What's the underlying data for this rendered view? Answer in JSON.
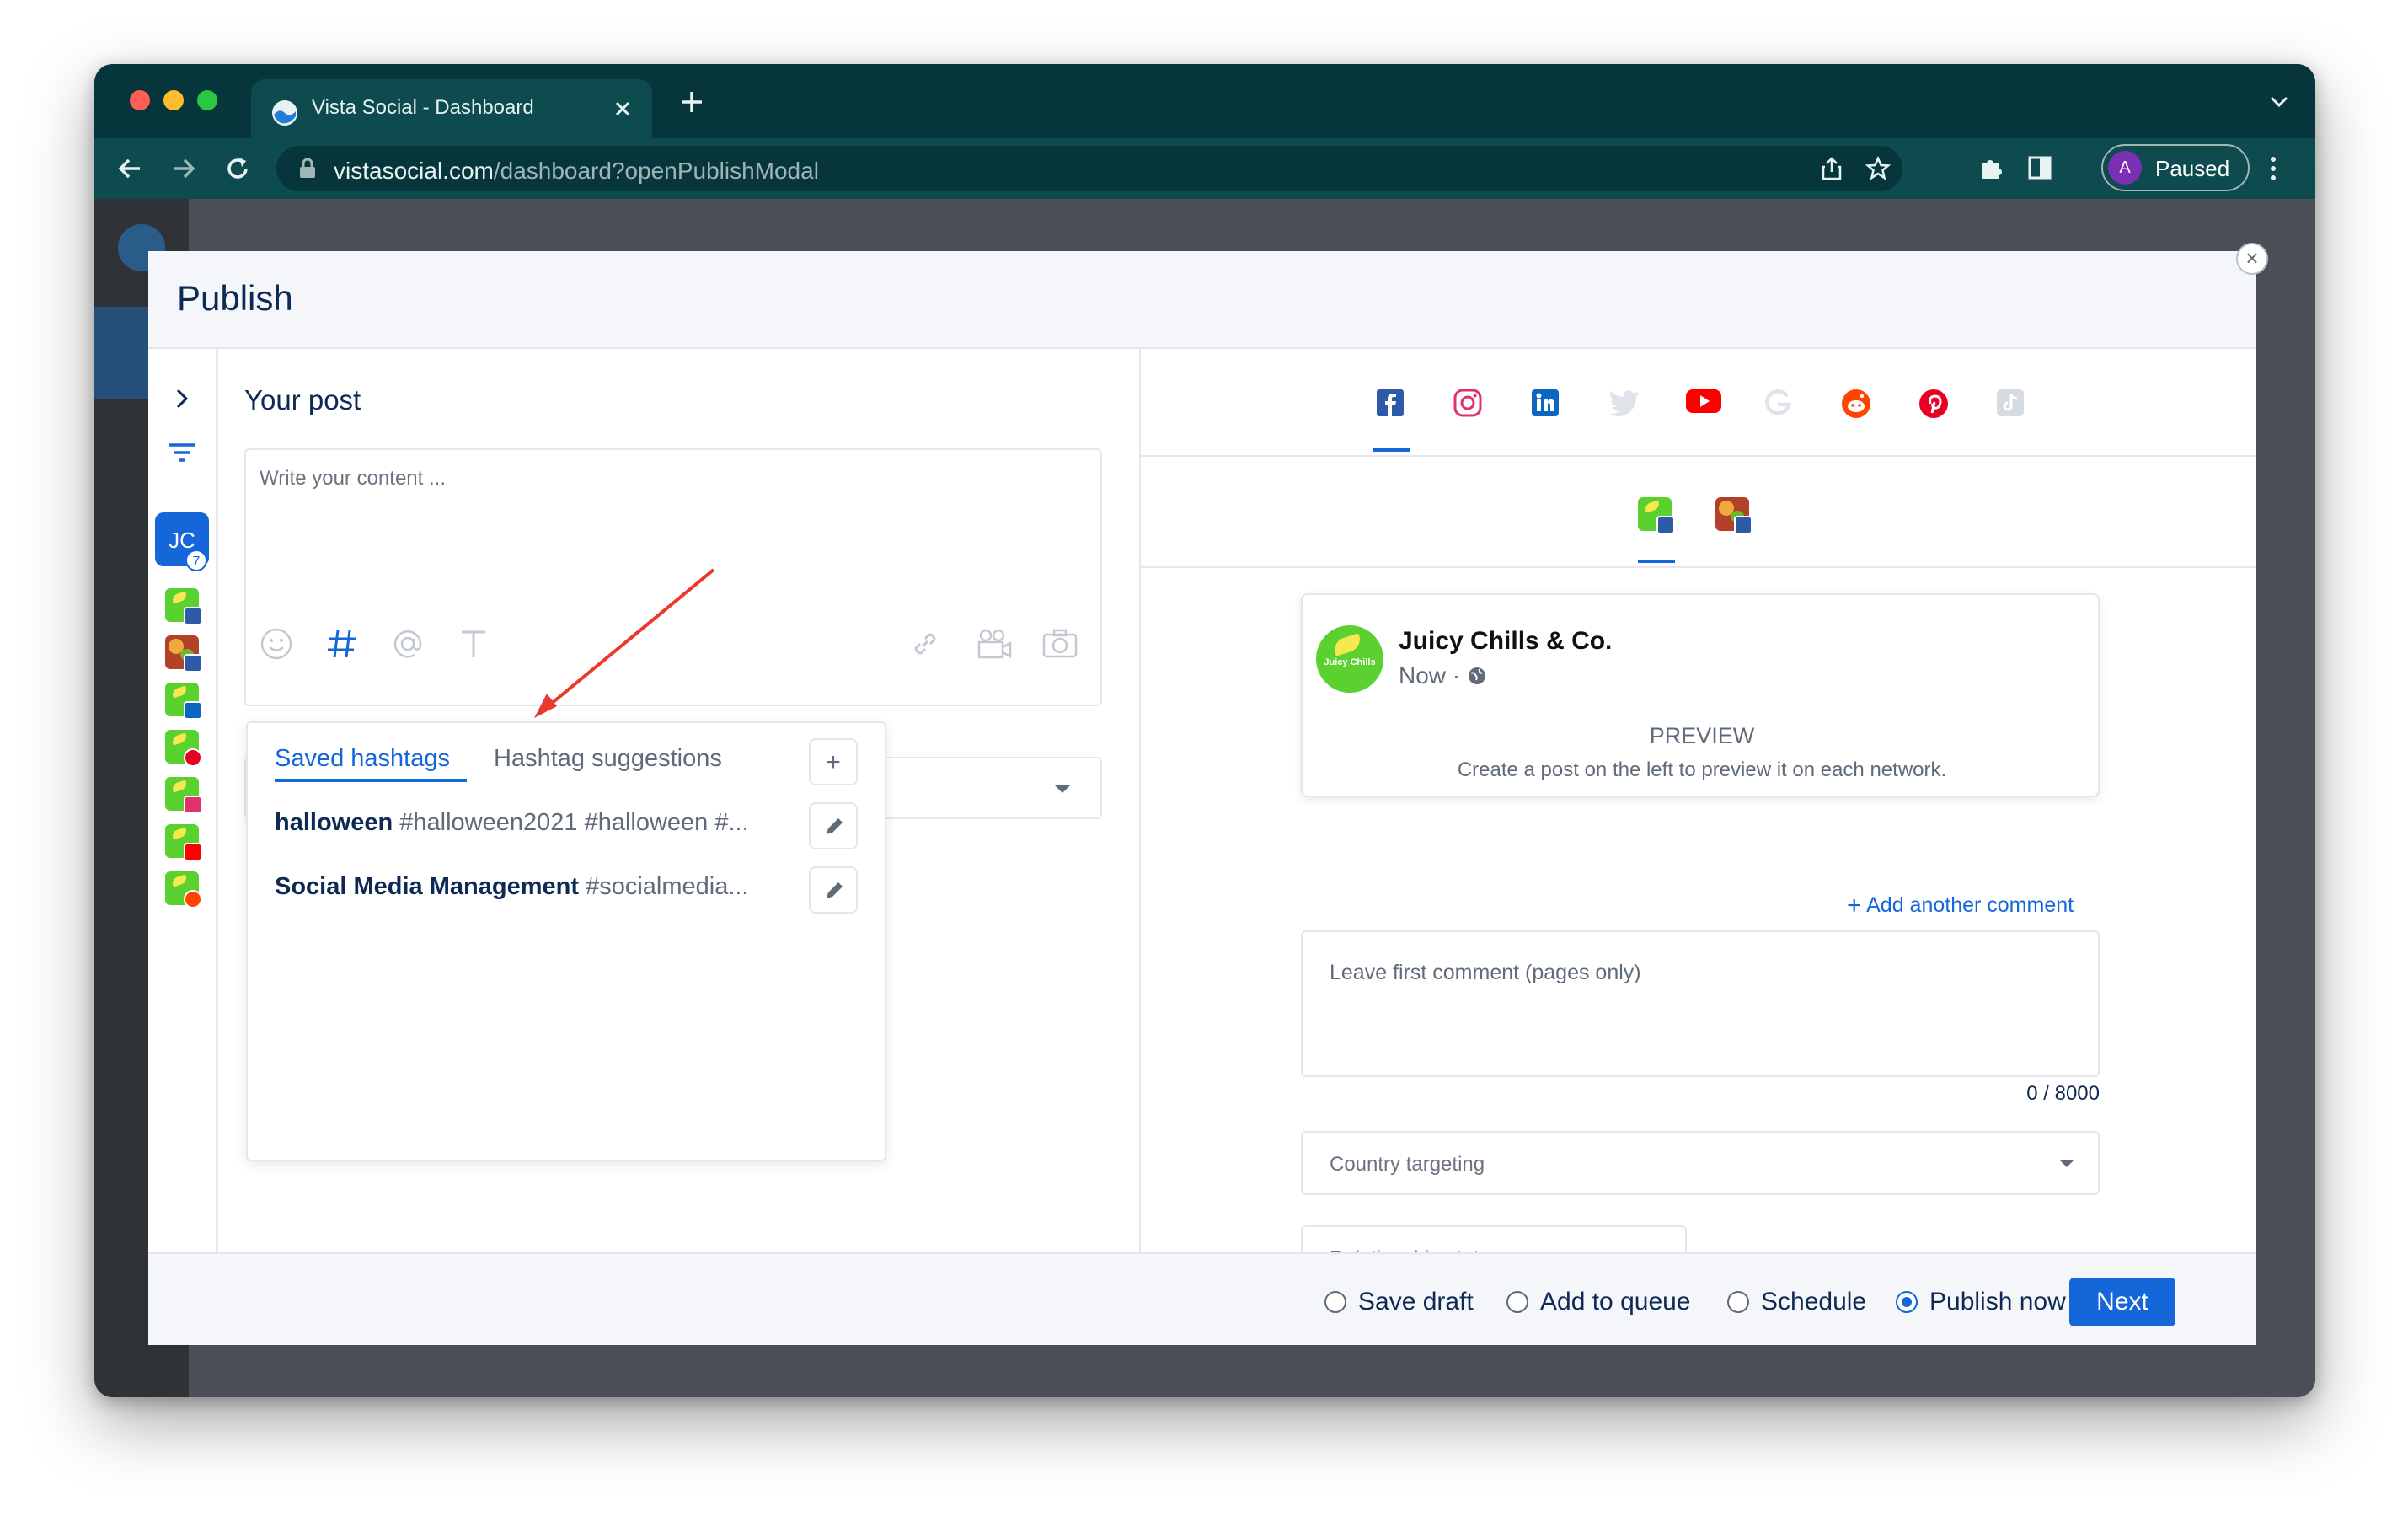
{
  "browser": {
    "tab_title": "Vista Social - Dashboard",
    "url_host": "vistasocial.com",
    "url_path": "/dashboard?openPublishModal",
    "profile_initial": "A",
    "profile_label": "Paused"
  },
  "modal": {
    "title": "Publish",
    "close_label": "×"
  },
  "accounts": {
    "group_initials": "JC",
    "group_count": "7",
    "networks": [
      "facebook",
      "facebook",
      "linkedin",
      "pinterest",
      "instagram",
      "youtube",
      "reddit"
    ]
  },
  "editor": {
    "section_title": "Your post",
    "placeholder": "Write your content ...",
    "tools_left": [
      "emoji-icon",
      "hashtag-icon",
      "mention-icon",
      "text-format-icon"
    ],
    "tools_right": [
      "link-icon",
      "video-icon",
      "camera-icon"
    ]
  },
  "hashtags": {
    "tab_saved": "Saved hashtags",
    "tab_suggestions": "Hashtag suggestions",
    "add_label": "+",
    "items": [
      {
        "name": "halloween",
        "tags": "#halloween2021 #halloween #..."
      },
      {
        "name": "Social Media Management",
        "tags": "#socialmedia..."
      }
    ]
  },
  "preview": {
    "network_tabs": [
      "facebook",
      "instagram",
      "linkedin",
      "twitter",
      "youtube",
      "google",
      "reddit",
      "pinterest",
      "tiktok"
    ],
    "active_network": "facebook",
    "page_name": "Juicy Chills & Co.",
    "logo_text": "Juicy Chills",
    "post_time": "Now ·",
    "preview_title": "PREVIEW",
    "preview_hint": "Create a post on the left to preview it on each network.",
    "add_comment": "Add another comment",
    "comment_placeholder": "Leave first comment (pages only)",
    "char_count": "0 / 8000",
    "country_targeting": "Country targeting",
    "relationship_status": "Relationship status"
  },
  "footer": {
    "options": [
      {
        "label": "Save draft",
        "selected": false
      },
      {
        "label": "Add to queue",
        "selected": false
      },
      {
        "label": "Schedule",
        "selected": false
      },
      {
        "label": "Publish now",
        "selected": true
      }
    ],
    "next_label": "Next"
  },
  "colors": {
    "accent": "#1566d8",
    "annotation_arrow": "#e8392b",
    "browser_chrome": "#06363b"
  }
}
